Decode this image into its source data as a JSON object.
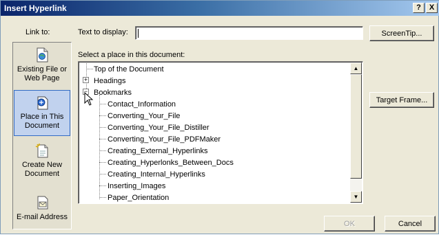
{
  "title": "Insert Hyperlink",
  "help_btn": "?",
  "close_btn": "X",
  "link_to_label": "Link to:",
  "text_to_display_label": "Text to display:",
  "text_to_display_value": "",
  "screentip_btn": "ScreenTip...",
  "select_place_label": "Select a place in this document:",
  "target_frame_btn": "Target Frame...",
  "ok_btn": "OK",
  "cancel_btn": "Cancel",
  "places": [
    {
      "line1": "Existing File or",
      "line2": "Web Page",
      "icon": "existing-file-icon"
    },
    {
      "line1": "Place in This",
      "line2": "Document",
      "icon": "place-in-document-icon"
    },
    {
      "line1": "Create New",
      "line2": "Document",
      "icon": "create-new-document-icon"
    },
    {
      "line1": "E-mail Address",
      "line2": "",
      "icon": "email-icon"
    }
  ],
  "tree": {
    "top": "Top of the Document",
    "headings": "Headings",
    "bookmarks": "Bookmarks",
    "bookmark_items": [
      "Contact_Information",
      "Converting_Your_File",
      "Converting_Your_File_Distiller",
      "Converting_Your_File_PDFMaker",
      "Creating_External_Hyperlinks",
      "Creating_Hyperlonks_Between_Docs",
      "Creating_Internal_Hyperlinks",
      "Inserting_Images",
      "Paper_Orientation"
    ]
  }
}
